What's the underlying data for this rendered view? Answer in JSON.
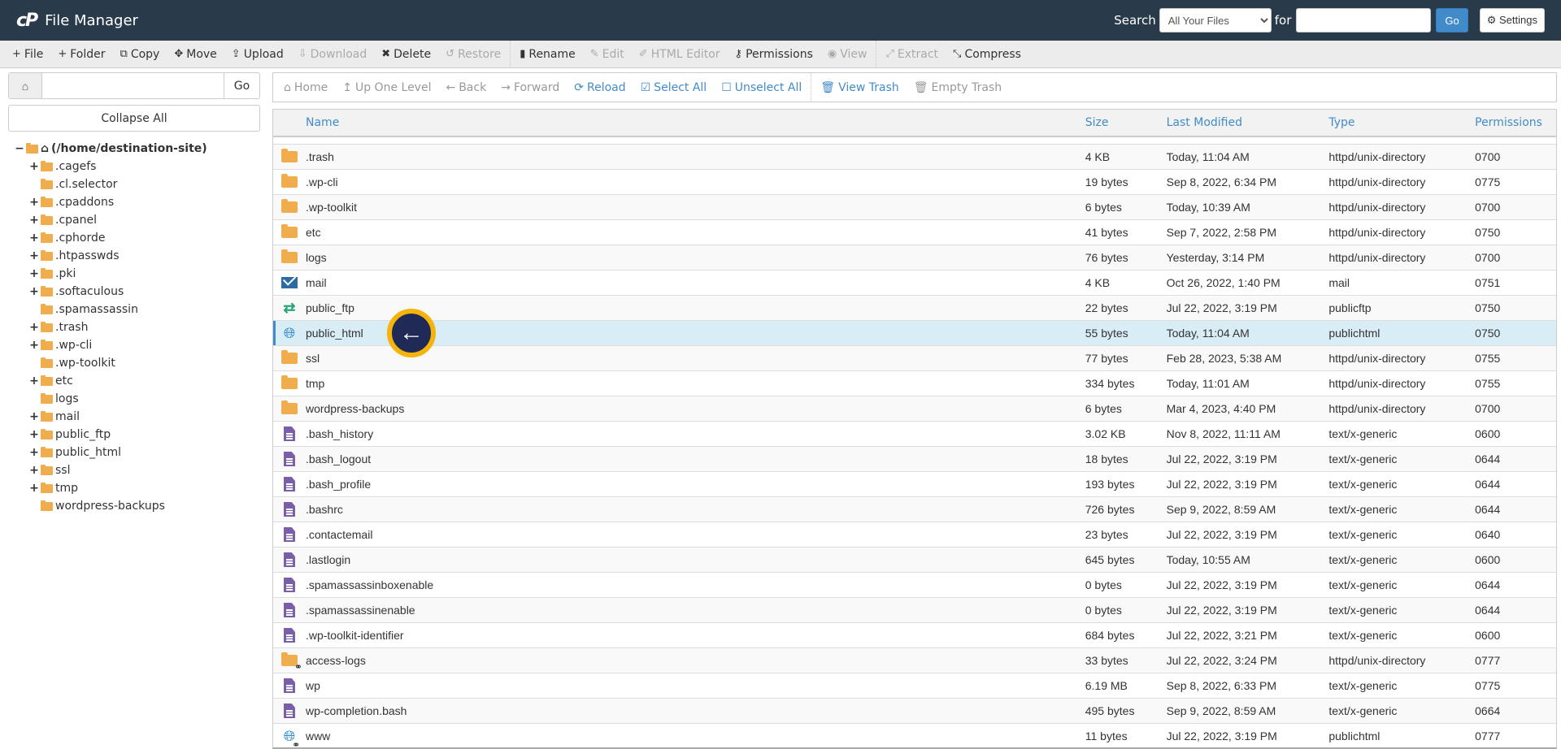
{
  "header": {
    "logo": "cP",
    "title": "File Manager",
    "search_label": "Search",
    "search_scope": "All Your Files",
    "for_label": "for",
    "search_value": "",
    "go_label": "Go",
    "settings_label": "Settings"
  },
  "toolbar": [
    {
      "label": "File",
      "icon": "+",
      "name": "new-file",
      "disabled": false
    },
    {
      "label": "Folder",
      "icon": "+",
      "name": "new-folder",
      "disabled": false
    },
    {
      "label": "Copy",
      "icon": "⧉",
      "name": "copy",
      "disabled": false
    },
    {
      "label": "Move",
      "icon": "✥",
      "name": "move",
      "disabled": false
    },
    {
      "label": "Upload",
      "icon": "⇪",
      "name": "upload",
      "disabled": false
    },
    {
      "label": "Download",
      "icon": "⇩",
      "name": "download",
      "disabled": true
    },
    {
      "label": "Delete",
      "icon": "✖",
      "name": "delete",
      "disabled": false
    },
    {
      "label": "Restore",
      "icon": "↺",
      "name": "restore",
      "disabled": true
    },
    {
      "label": "Rename",
      "icon": "▮",
      "name": "rename",
      "disabled": false
    },
    {
      "label": "Edit",
      "icon": "✎",
      "name": "edit",
      "disabled": true
    },
    {
      "label": "HTML Editor",
      "icon": "✐",
      "name": "html-editor",
      "disabled": true
    },
    {
      "label": "Permissions",
      "icon": "⚷",
      "name": "permissions",
      "disabled": false
    },
    {
      "label": "View",
      "icon": "◉",
      "name": "view",
      "disabled": true
    },
    {
      "label": "Extract",
      "icon": "⤢",
      "name": "extract",
      "disabled": true
    },
    {
      "label": "Compress",
      "icon": "⤡",
      "name": "compress",
      "disabled": false
    }
  ],
  "sidebar": {
    "path_value": "",
    "go_label": "Go",
    "collapse_label": "Collapse All",
    "root_label": "(/home/destination-site)",
    "items": [
      {
        "label": ".cagefs",
        "expandable": true
      },
      {
        "label": ".cl.selector",
        "expandable": false
      },
      {
        "label": ".cpaddons",
        "expandable": true
      },
      {
        "label": ".cpanel",
        "expandable": true
      },
      {
        "label": ".cphorde",
        "expandable": true
      },
      {
        "label": ".htpasswds",
        "expandable": true
      },
      {
        "label": ".pki",
        "expandable": true
      },
      {
        "label": ".softaculous",
        "expandable": true
      },
      {
        "label": ".spamassassin",
        "expandable": false
      },
      {
        "label": ".trash",
        "expandable": true
      },
      {
        "label": ".wp-cli",
        "expandable": true
      },
      {
        "label": ".wp-toolkit",
        "expandable": false
      },
      {
        "label": "etc",
        "expandable": true
      },
      {
        "label": "logs",
        "expandable": false
      },
      {
        "label": "mail",
        "expandable": true
      },
      {
        "label": "public_ftp",
        "expandable": true
      },
      {
        "label": "public_html",
        "expandable": true
      },
      {
        "label": "ssl",
        "expandable": true
      },
      {
        "label": "tmp",
        "expandable": true
      },
      {
        "label": "wordpress-backups",
        "expandable": false
      }
    ]
  },
  "nav": [
    {
      "label": "Home",
      "icon": "⌂",
      "name": "home",
      "active": false
    },
    {
      "label": "Up One Level",
      "icon": "↥",
      "name": "up-one-level",
      "active": false
    },
    {
      "label": "Back",
      "icon": "←",
      "name": "back",
      "active": false
    },
    {
      "label": "Forward",
      "icon": "→",
      "name": "forward",
      "active": false
    },
    {
      "label": "Reload",
      "icon": "⟳",
      "name": "reload",
      "active": true
    },
    {
      "label": "Select All",
      "icon": "☑",
      "name": "select-all",
      "active": true
    },
    {
      "label": "Unselect All",
      "icon": "☐",
      "name": "unselect-all",
      "active": true
    },
    {
      "label": "View Trash",
      "icon": "🗑",
      "name": "view-trash",
      "active": true
    },
    {
      "label": "Empty Trash",
      "icon": "🗑",
      "name": "empty-trash",
      "active": false
    }
  ],
  "columns": {
    "name": "Name",
    "size": "Size",
    "modified": "Last Modified",
    "type": "Type",
    "permissions": "Permissions"
  },
  "files": [
    {
      "icon": "folder",
      "name": ".trash",
      "size": "4 KB",
      "modified": "Today, 11:04 AM",
      "type": "httpd/unix-directory",
      "perm": "0700"
    },
    {
      "icon": "folder",
      "name": ".wp-cli",
      "size": "19 bytes",
      "modified": "Sep 8, 2022, 6:34 PM",
      "type": "httpd/unix-directory",
      "perm": "0775"
    },
    {
      "icon": "folder",
      "name": ".wp-toolkit",
      "size": "6 bytes",
      "modified": "Today, 10:39 AM",
      "type": "httpd/unix-directory",
      "perm": "0700"
    },
    {
      "icon": "folder",
      "name": "etc",
      "size": "41 bytes",
      "modified": "Sep 7, 2022, 2:58 PM",
      "type": "httpd/unix-directory",
      "perm": "0750"
    },
    {
      "icon": "folder",
      "name": "logs",
      "size": "76 bytes",
      "modified": "Yesterday, 3:14 PM",
      "type": "httpd/unix-directory",
      "perm": "0700"
    },
    {
      "icon": "mail",
      "name": "mail",
      "size": "4 KB",
      "modified": "Oct 26, 2022, 1:40 PM",
      "type": "mail",
      "perm": "0751"
    },
    {
      "icon": "ftp",
      "name": "public_ftp",
      "size": "22 bytes",
      "modified": "Jul 22, 2022, 3:19 PM",
      "type": "publicftp",
      "perm": "0750"
    },
    {
      "icon": "globe",
      "name": "public_html",
      "size": "55 bytes",
      "modified": "Today, 11:04 AM",
      "type": "publichtml",
      "perm": "0750",
      "selected": true
    },
    {
      "icon": "folder",
      "name": "ssl",
      "size": "77 bytes",
      "modified": "Feb 28, 2023, 5:38 AM",
      "type": "httpd/unix-directory",
      "perm": "0755"
    },
    {
      "icon": "folder",
      "name": "tmp",
      "size": "334 bytes",
      "modified": "Today, 11:01 AM",
      "type": "httpd/unix-directory",
      "perm": "0755"
    },
    {
      "icon": "folder",
      "name": "wordpress-backups",
      "size": "6 bytes",
      "modified": "Mar 4, 2023, 4:40 PM",
      "type": "httpd/unix-directory",
      "perm": "0700"
    },
    {
      "icon": "file",
      "name": ".bash_history",
      "size": "3.02 KB",
      "modified": "Nov 8, 2022, 11:11 AM",
      "type": "text/x-generic",
      "perm": "0600"
    },
    {
      "icon": "file",
      "name": ".bash_logout",
      "size": "18 bytes",
      "modified": "Jul 22, 2022, 3:19 PM",
      "type": "text/x-generic",
      "perm": "0644"
    },
    {
      "icon": "file",
      "name": ".bash_profile",
      "size": "193 bytes",
      "modified": "Jul 22, 2022, 3:19 PM",
      "type": "text/x-generic",
      "perm": "0644"
    },
    {
      "icon": "file",
      "name": ".bashrc",
      "size": "726 bytes",
      "modified": "Sep 9, 2022, 8:59 AM",
      "type": "text/x-generic",
      "perm": "0644"
    },
    {
      "icon": "file",
      "name": ".contactemail",
      "size": "23 bytes",
      "modified": "Jul 22, 2022, 3:19 PM",
      "type": "text/x-generic",
      "perm": "0640"
    },
    {
      "icon": "file",
      "name": ".lastlogin",
      "size": "645 bytes",
      "modified": "Today, 10:55 AM",
      "type": "text/x-generic",
      "perm": "0600"
    },
    {
      "icon": "file",
      "name": ".spamassassinboxenable",
      "size": "0 bytes",
      "modified": "Jul 22, 2022, 3:19 PM",
      "type": "text/x-generic",
      "perm": "0644"
    },
    {
      "icon": "file",
      "name": ".spamassassinenable",
      "size": "0 bytes",
      "modified": "Jul 22, 2022, 3:19 PM",
      "type": "text/x-generic",
      "perm": "0644"
    },
    {
      "icon": "file",
      "name": ".wp-toolkit-identifier",
      "size": "684 bytes",
      "modified": "Jul 22, 2022, 3:21 PM",
      "type": "text/x-generic",
      "perm": "0600"
    },
    {
      "icon": "folder-link",
      "name": "access-logs",
      "size": "33 bytes",
      "modified": "Jul 22, 2022, 3:24 PM",
      "type": "httpd/unix-directory",
      "perm": "0777"
    },
    {
      "icon": "file",
      "name": "wp",
      "size": "6.19 MB",
      "modified": "Sep 8, 2022, 6:33 PM",
      "type": "text/x-generic",
      "perm": "0775"
    },
    {
      "icon": "file",
      "name": "wp-completion.bash",
      "size": "495 bytes",
      "modified": "Sep 9, 2022, 8:59 AM",
      "type": "text/x-generic",
      "perm": "0664"
    },
    {
      "icon": "globe-link",
      "name": "www",
      "size": "11 bytes",
      "modified": "Jul 22, 2022, 3:19 PM",
      "type": "publichtml",
      "perm": "0777"
    }
  ],
  "overlay": {
    "cursor_icon": "←"
  },
  "colors": {
    "header_bg": "#293a4a",
    "accent": "#428bca",
    "folder": "#f0ad4e",
    "file": "#7a5fa8",
    "selected_row": "#d9edf7"
  }
}
